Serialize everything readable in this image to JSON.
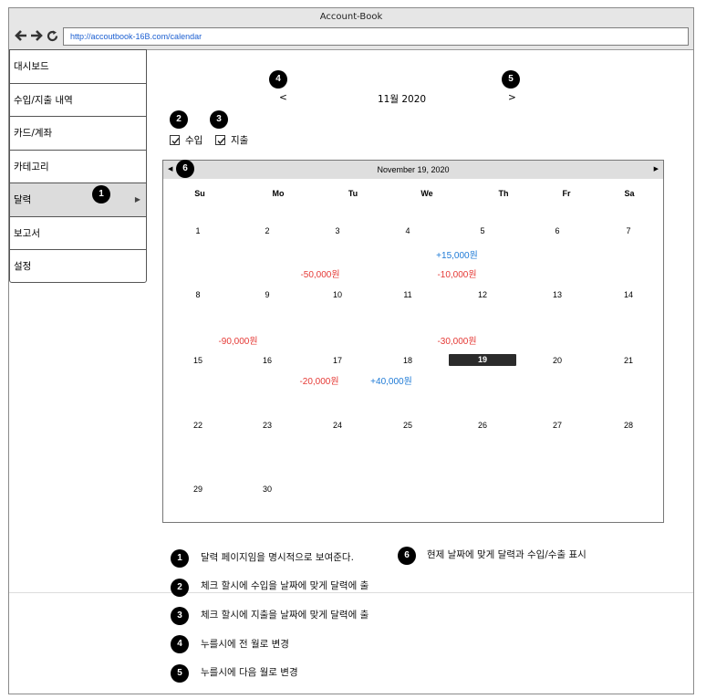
{
  "window": {
    "title": "Account-Book"
  },
  "browser": {
    "url": "http://accoutbook-16B.com/calendar"
  },
  "sidebar": {
    "items": [
      {
        "label": "대시보드"
      },
      {
        "label": "수입/지출 내역"
      },
      {
        "label": "카드/계좌"
      },
      {
        "label": "카테고리"
      },
      {
        "label": "달력",
        "active": true
      },
      {
        "label": "보고서"
      },
      {
        "label": "설정"
      }
    ]
  },
  "month_nav": {
    "prev": "<",
    "label": "11월 2020",
    "next": ">"
  },
  "filters": {
    "income_label": "수입",
    "expense_label": "지출",
    "income_checked": true,
    "expense_checked": true
  },
  "calendar": {
    "header": "November 19, 2020",
    "weekdays": [
      "Su",
      "Mo",
      "Tu",
      "We",
      "Th",
      "Fr",
      "Sa"
    ],
    "weeks": [
      [
        "1",
        "2",
        "3",
        "4",
        "5",
        "6",
        "7"
      ],
      [
        "8",
        "9",
        "10",
        "11",
        "12",
        "13",
        "14"
      ],
      [
        "15",
        "16",
        "17",
        "18",
        "19",
        "20",
        "21"
      ],
      [
        "22",
        "23",
        "24",
        "25",
        "26",
        "27",
        "28"
      ],
      [
        "29",
        "30"
      ]
    ],
    "today": "19",
    "amounts": [
      {
        "text": "+15,000원",
        "type": "income"
      },
      {
        "text": "-50,000원",
        "type": "expense"
      },
      {
        "text": "-10,000원",
        "type": "expense"
      },
      {
        "text": "-90,000원",
        "type": "expense"
      },
      {
        "text": "-30,000원",
        "type": "expense"
      },
      {
        "text": "-20,000원",
        "type": "expense"
      },
      {
        "text": "+40,000원",
        "type": "income"
      }
    ]
  },
  "badges": [
    "1",
    "2",
    "3",
    "4",
    "5",
    "6"
  ],
  "notes": [
    {
      "num": "1",
      "text": "달력 페이지임을 명시적으로 보여준다."
    },
    {
      "num": "6",
      "text": "현제 날짜에 맞게 달력과 수입/수출 표시"
    },
    {
      "num": "2",
      "text": "체크 할시에 수입을 날짜에 맞게 달력에 출"
    },
    {
      "num": "3",
      "text": "체크 할시에 지출을 날짜에 맞게 달력에 출"
    },
    {
      "num": "4",
      "text": "누를시에 전 월로 변경"
    },
    {
      "num": "5",
      "text": "누를시에 다음 월로 변경"
    }
  ],
  "colors": {
    "income": "#1e7ad6",
    "expense": "#e53935",
    "today_bg": "#2b2b2b",
    "accent": "#000000"
  }
}
